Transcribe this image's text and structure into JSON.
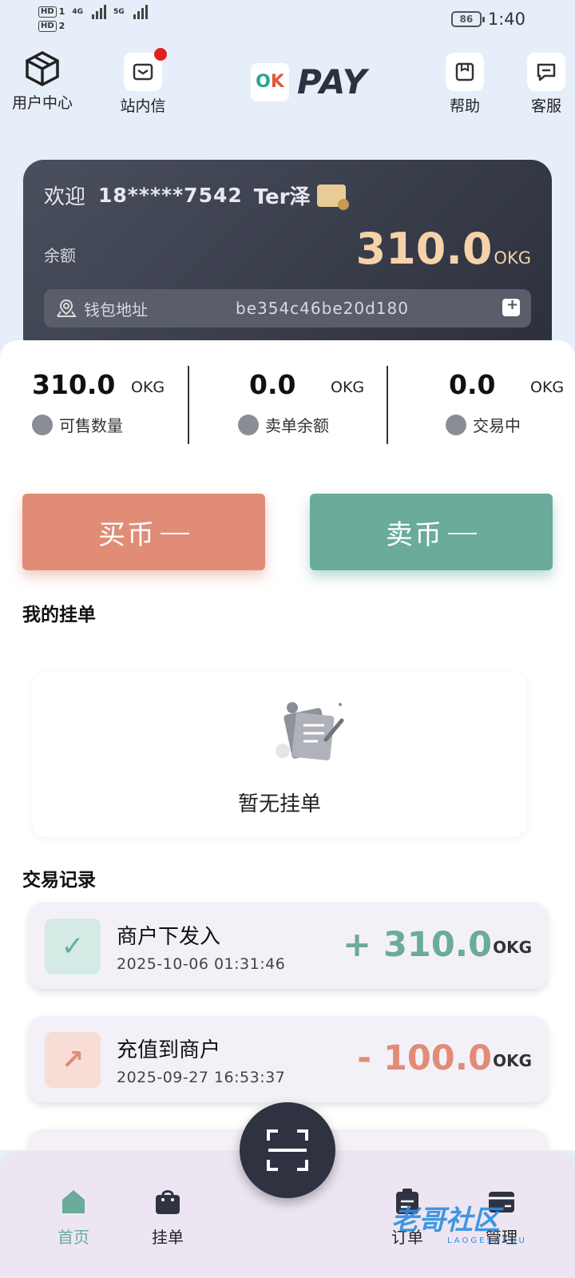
{
  "status_bar": {
    "hd1": "HD",
    "sim1": "1",
    "hd2": "HD",
    "sim2": "2",
    "net1": "4G",
    "net2": "5G",
    "battery": "86",
    "time": "1:40"
  },
  "topnav": {
    "user_center": "用户中心",
    "inbox": "站内信",
    "logo_ok": "OK",
    "logo_pay": "PAY",
    "help": "帮助",
    "service": "客服"
  },
  "account": {
    "welcome": "欢迎",
    "phone": "18*****7542",
    "username": "Ter泽",
    "balance_label": "余额",
    "balance": "310.0",
    "unit": "OKG",
    "address_label": "钱包地址",
    "address": "be354c46be20d180"
  },
  "stats": [
    {
      "value": "310.0",
      "unit": "OKG",
      "label": "可售数量"
    },
    {
      "value": "0.0",
      "unit": "OKG",
      "label": "卖单余额"
    },
    {
      "value": "0.0",
      "unit": "OKG",
      "label": "交易中"
    }
  ],
  "actions": {
    "buy": "买币",
    "sell": "卖币"
  },
  "my_orders": {
    "title": "我的挂单",
    "empty": "暂无挂单"
  },
  "records": {
    "title": "交易记录",
    "items": [
      {
        "title": "商户下发入",
        "time": "2025-10-06 01:31:46",
        "amount": "+ 310.0",
        "unit": "OKG",
        "color": "#6aab9b"
      },
      {
        "title": "充值到商户",
        "time": "2025-09-27 16:53:37",
        "amount": "- 100.0",
        "unit": "OKG",
        "color": "#e08c77"
      }
    ]
  },
  "tabs": {
    "home": "首页",
    "orders_list": "挂单",
    "order": "订单",
    "manage": "管理"
  },
  "watermark": {
    "text": "老哥社区",
    "sub": "LAOGESHEQU"
  }
}
